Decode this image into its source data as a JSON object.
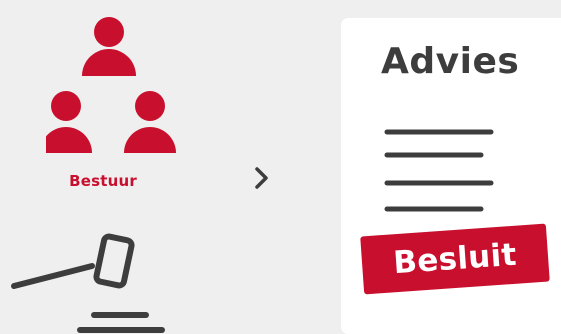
{
  "governance": {
    "group_label": "Bestuur",
    "group_icon": "people-group-icon",
    "gavel_icon": "gavel-icon"
  },
  "flow": {
    "arrow_icon": "chevron-right-icon"
  },
  "document": {
    "title": "Advies",
    "lines_icon": "text-lines-icon",
    "stamp_label": "Besluit"
  },
  "colors": {
    "accent": "#c8102e",
    "dark": "#3d3d3d",
    "background": "#efefef",
    "card": "#ffffff"
  }
}
